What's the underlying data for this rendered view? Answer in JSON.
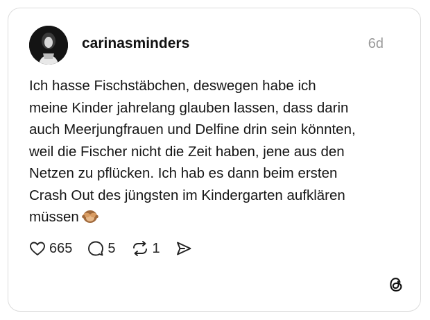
{
  "post": {
    "author": "carinasminders",
    "timestamp": "6d",
    "text": "Ich hasse Fischstäbchen, deswegen habe ich\nmeine Kinder jahrelang glauben lassen, dass darin\nauch Meerjungfrauen und Delfine drin sein könnten,\nweil die Fischer nicht die Zeit haben, jene aus den\nNetzen zu pflücken. Ich hab es dann beim ersten\nCrash Out des jüngsten im Kindergarten aufklären\nmüssen",
    "emoji": "see-no-evil-monkey"
  },
  "actions": {
    "likes": "665",
    "replies": "5",
    "reposts": "1"
  },
  "icons": [
    "heart-icon",
    "comment-icon",
    "repost-icon",
    "share-icon",
    "threads-logo-icon"
  ],
  "colors": {
    "text": "#151515",
    "muted": "#9a9a9a",
    "border": "#dcdcdc"
  }
}
